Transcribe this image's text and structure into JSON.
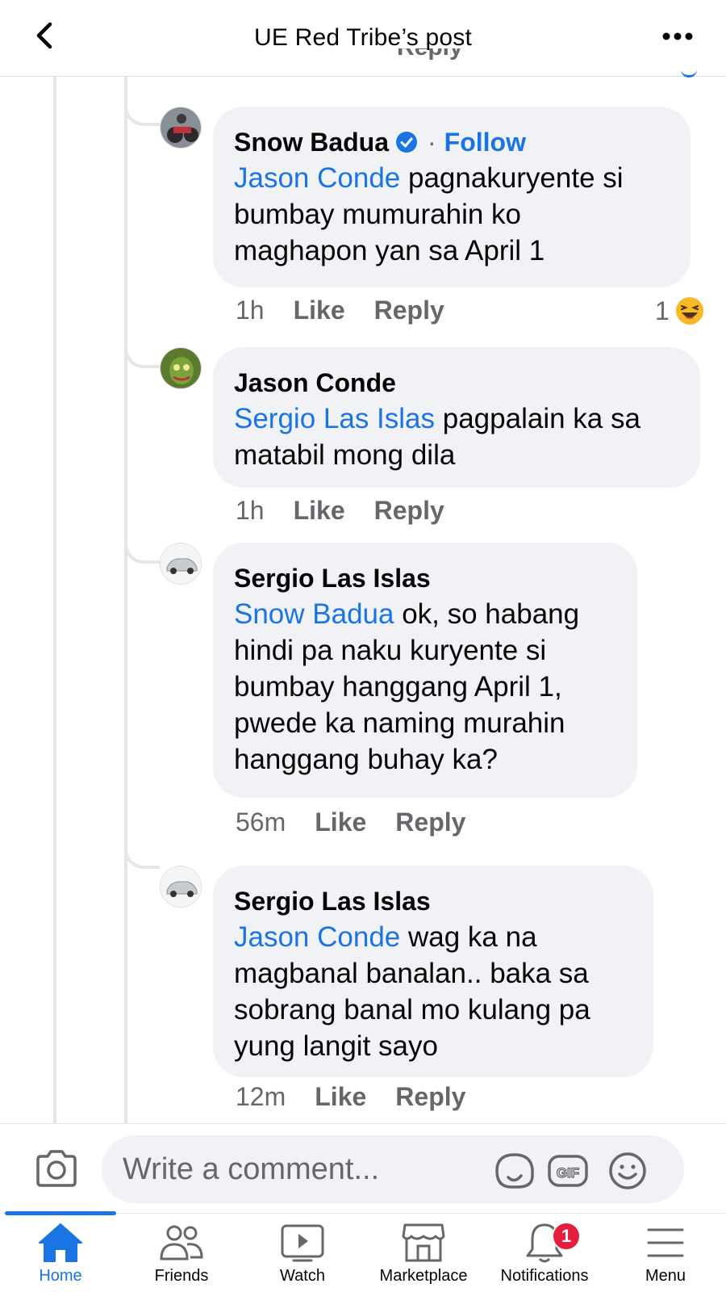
{
  "header": {
    "title": "UE Red Tribe’s post",
    "partial_text": "Reply"
  },
  "comments": [
    {
      "author": "Snow Badua",
      "verified": true,
      "follow_label": "Follow",
      "follow_sep": "·",
      "mention": "Jason Conde",
      "text_line1": " pagnakuryente si",
      "text_line2": "bumbay mumurahin ko",
      "text_line3": "maghapon yan sa April 1",
      "time": "1h",
      "like": "Like",
      "reply": "Reply",
      "reaction_count": "1",
      "reaction_icon": "haha-emoji-icon"
    },
    {
      "author": "Jason Conde",
      "mention": "Sergio Las Islas",
      "text_line1": " pagpalain ka sa",
      "text_line2": "matabil mong dila",
      "time": "1h",
      "like": "Like",
      "reply": "Reply"
    },
    {
      "author": "Sergio Las Islas",
      "mention": "Snow Badua",
      "text_line1": " ok, so habang",
      "text_line2": "hindi pa naku kuryente si",
      "text_line3": "bumbay hanggang April 1,",
      "text_line4": "pwede ka naming murahin",
      "text_line5": "hanggang buhay ka?",
      "time": "56m",
      "like": "Like",
      "reply": "Reply"
    },
    {
      "author": "Sergio Las Islas",
      "mention": "Jason Conde",
      "text_line1": " wag ka na",
      "text_line2": "magbanal banalan.. baka sa",
      "text_line3": "sobrang banal mo kulang pa",
      "text_line4": "yung langit sayo",
      "time": "12m",
      "like": "Like",
      "reply": "Reply"
    }
  ],
  "composer": {
    "placeholder": "Write a comment...",
    "gif_label": "GIF"
  },
  "tabs": [
    {
      "label": "Home",
      "active": true
    },
    {
      "label": "Friends"
    },
    {
      "label": "Watch"
    },
    {
      "label": "Marketplace"
    },
    {
      "label": "Notifications",
      "badge": "1"
    },
    {
      "label": "Menu"
    }
  ],
  "colors": {
    "accent": "#1b74e4",
    "bubble": "#f0f2f5",
    "secondary_text": "#65676b",
    "badge": "#e41e3f"
  }
}
